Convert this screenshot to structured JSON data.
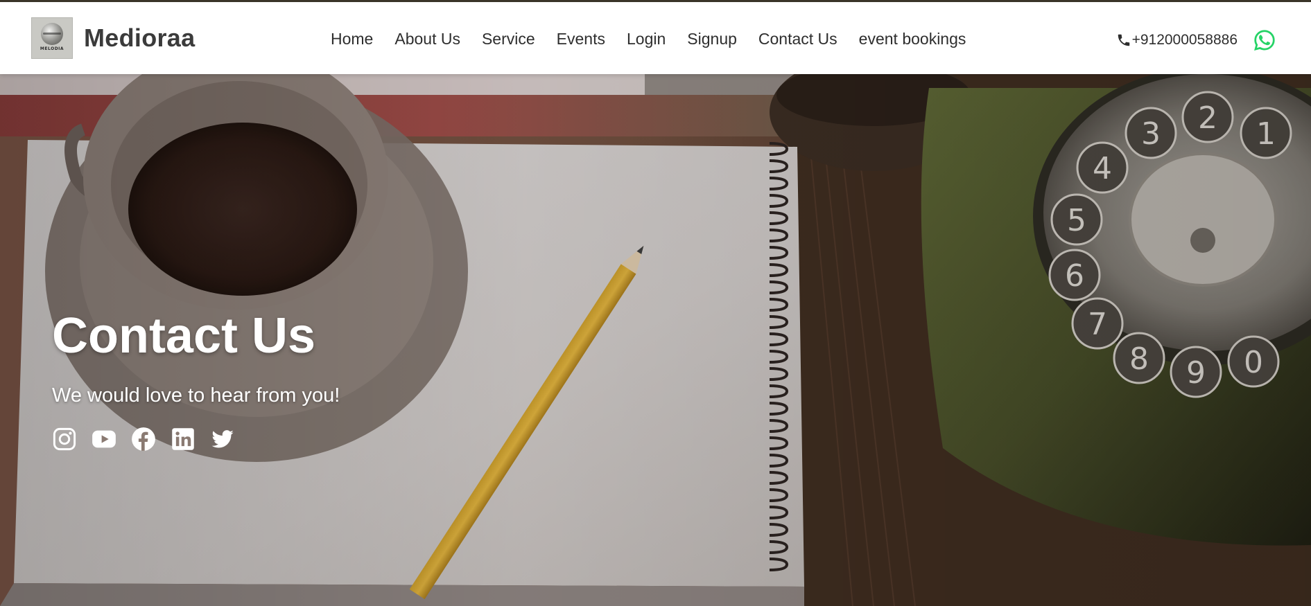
{
  "header": {
    "brand": {
      "name": "Medioraa",
      "logo_text": "MELODIA"
    },
    "nav": [
      {
        "label": "Home"
      },
      {
        "label": "About Us"
      },
      {
        "label": "Service"
      },
      {
        "label": "Events"
      },
      {
        "label": "Login"
      },
      {
        "label": "Signup"
      },
      {
        "label": "Contact Us"
      },
      {
        "label": "event bookings"
      }
    ],
    "contact": {
      "phone": "+912000058886",
      "phone_icon": "phone-icon",
      "whatsapp_icon": "whatsapp-icon"
    }
  },
  "hero": {
    "title": "Contact Us",
    "subtitle": "We would love to hear from you!",
    "socials": [
      {
        "icon": "instagram-icon"
      },
      {
        "icon": "youtube-icon"
      },
      {
        "icon": "facebook-icon"
      },
      {
        "icon": "linkedin-icon"
      },
      {
        "icon": "twitter-icon"
      }
    ]
  },
  "colors": {
    "text_dark": "#2e2e2e",
    "whatsapp": "#25d366",
    "hero_text": "#ffffff"
  }
}
